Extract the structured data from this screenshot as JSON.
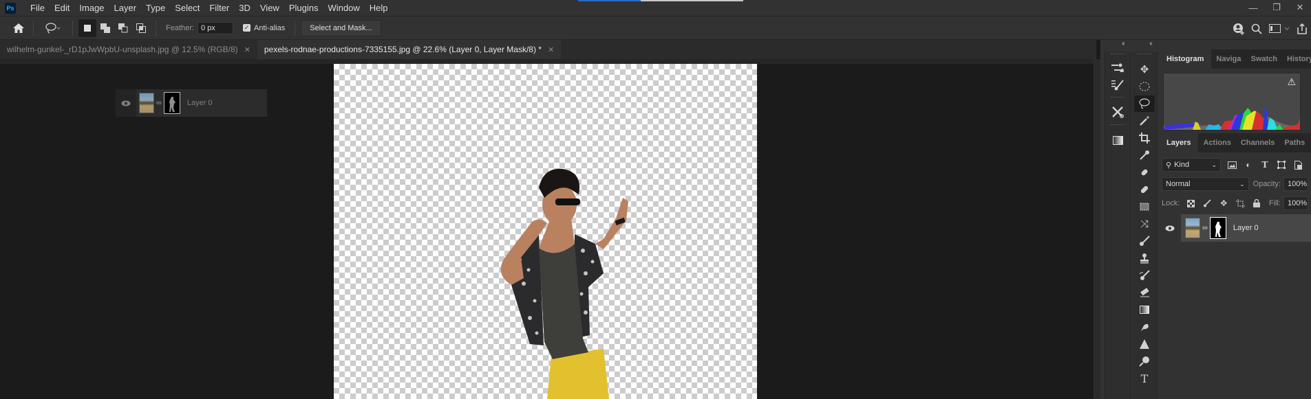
{
  "app": {
    "logo": "Ps",
    "menu": [
      "File",
      "Edit",
      "Image",
      "Layer",
      "Type",
      "Select",
      "Filter",
      "3D",
      "View",
      "Plugins",
      "Window",
      "Help"
    ],
    "window_controls": {
      "minimize": "minimize-icon",
      "restore": "restore-icon",
      "close": "close-icon"
    },
    "top_indicator_progress": 0.38
  },
  "options_bar": {
    "home_icon": "home-icon",
    "tool_icon": "lasso-icon",
    "selection_modes": [
      "new-selection",
      "add-to-selection",
      "subtract-from-selection",
      "intersect-selection"
    ],
    "active_mode_index": 0,
    "feather_label": "Feather:",
    "feather_value": "0 px",
    "anti_alias_label": "Anti-alias",
    "anti_alias_checked": true,
    "select_and_mask_label": "Select and Mask...",
    "right_icons": [
      "share-user-icon",
      "search-icon",
      "workspace-icon",
      "share-icon"
    ]
  },
  "tabs": [
    {
      "label": "wilhelm-gunkel-_rD1pJwWpbU-unsplash.jpg @ 12.5% (RGB/8)",
      "active": false
    },
    {
      "label": "pexels-rodnae-productions-7335155.jpg @ 22.6% (Layer 0, Layer Mask/8) *",
      "active": true
    }
  ],
  "canvas": {
    "subject": "Man dancing in sunglasses, patterned shirt and yellow pants on transparent background"
  },
  "dragged_layer": {
    "name": "Layer 0"
  },
  "dock": {
    "column1_tools": [
      "properties-icon",
      "brush-settings-icon",
      "tools-wrench-icon",
      "gradient-swatch-icon"
    ],
    "column2_tools": [
      "move-tool",
      "marquee-tool",
      "lasso-tool",
      "magic-wand-tool",
      "crop-tool",
      "eyedropper-tool",
      "spot-healing-tool",
      "healing-tool",
      "patch-tool",
      "content-aware-move-tool",
      "brush-tool",
      "clone-stamp-tool",
      "history-brush-tool",
      "eraser-tool",
      "gradient-tool",
      "smudge-tool",
      "sharpen-tool",
      "dodge-tool",
      "type-tool"
    ],
    "active_tool": "lasso-tool"
  },
  "top_panel": {
    "tabs": [
      "Histogram",
      "Naviga",
      "Swatch",
      "History"
    ],
    "active_tab": "Histogram",
    "warning_icon": "warning-icon"
  },
  "layers_panel": {
    "tabs": [
      "Layers",
      "Actions",
      "Channels",
      "Paths"
    ],
    "active_tab": "Layers",
    "filter_label": "Kind",
    "blend_mode": "Normal",
    "opacity_label": "Opacity:",
    "opacity_value": "100%",
    "lock_label": "Lock:",
    "fill_label": "Fill:",
    "fill_value": "100%",
    "layers": [
      {
        "name": "Layer 0",
        "visible": true,
        "has_mask": true
      }
    ]
  },
  "colors": {
    "accent_blue": "#2c6cc7",
    "ps_blue": "#31a8ff"
  }
}
